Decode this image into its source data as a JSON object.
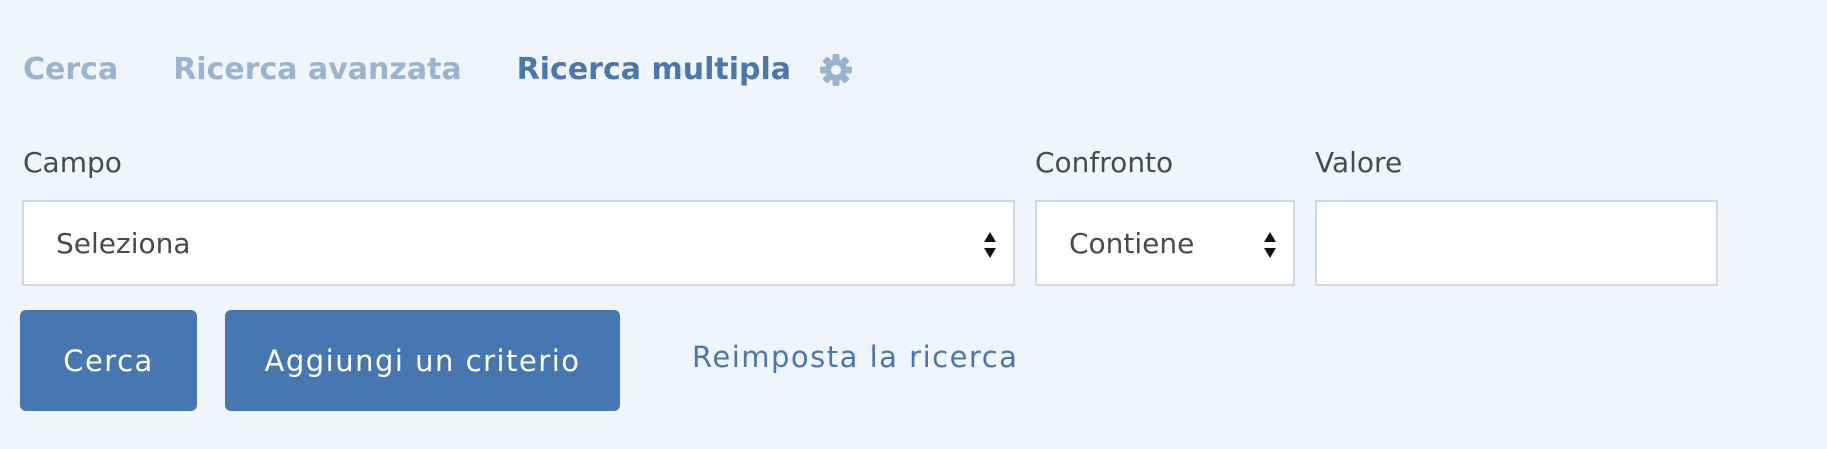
{
  "tabs": [
    {
      "label": "Cerca",
      "active": false
    },
    {
      "label": "Ricerca avanzata",
      "active": false
    },
    {
      "label": "Ricerca multipla",
      "active": true
    }
  ],
  "settings_icon": "gear-icon",
  "form": {
    "campo": {
      "label": "Campo",
      "value": "Seleziona"
    },
    "confronto": {
      "label": "Confronto",
      "value": "Contiene"
    },
    "valore": {
      "label": "Valore",
      "value": ""
    }
  },
  "actions": {
    "search_label": "Cerca",
    "add_criterion_label": "Aggiungi un criterio",
    "reset_label": "Reimposta la ricerca"
  },
  "colors": {
    "background": "#f0f4fb",
    "accent": "#4677b1",
    "tab_active": "#4a78ad",
    "tab_inactive": "#9ab3cf"
  }
}
